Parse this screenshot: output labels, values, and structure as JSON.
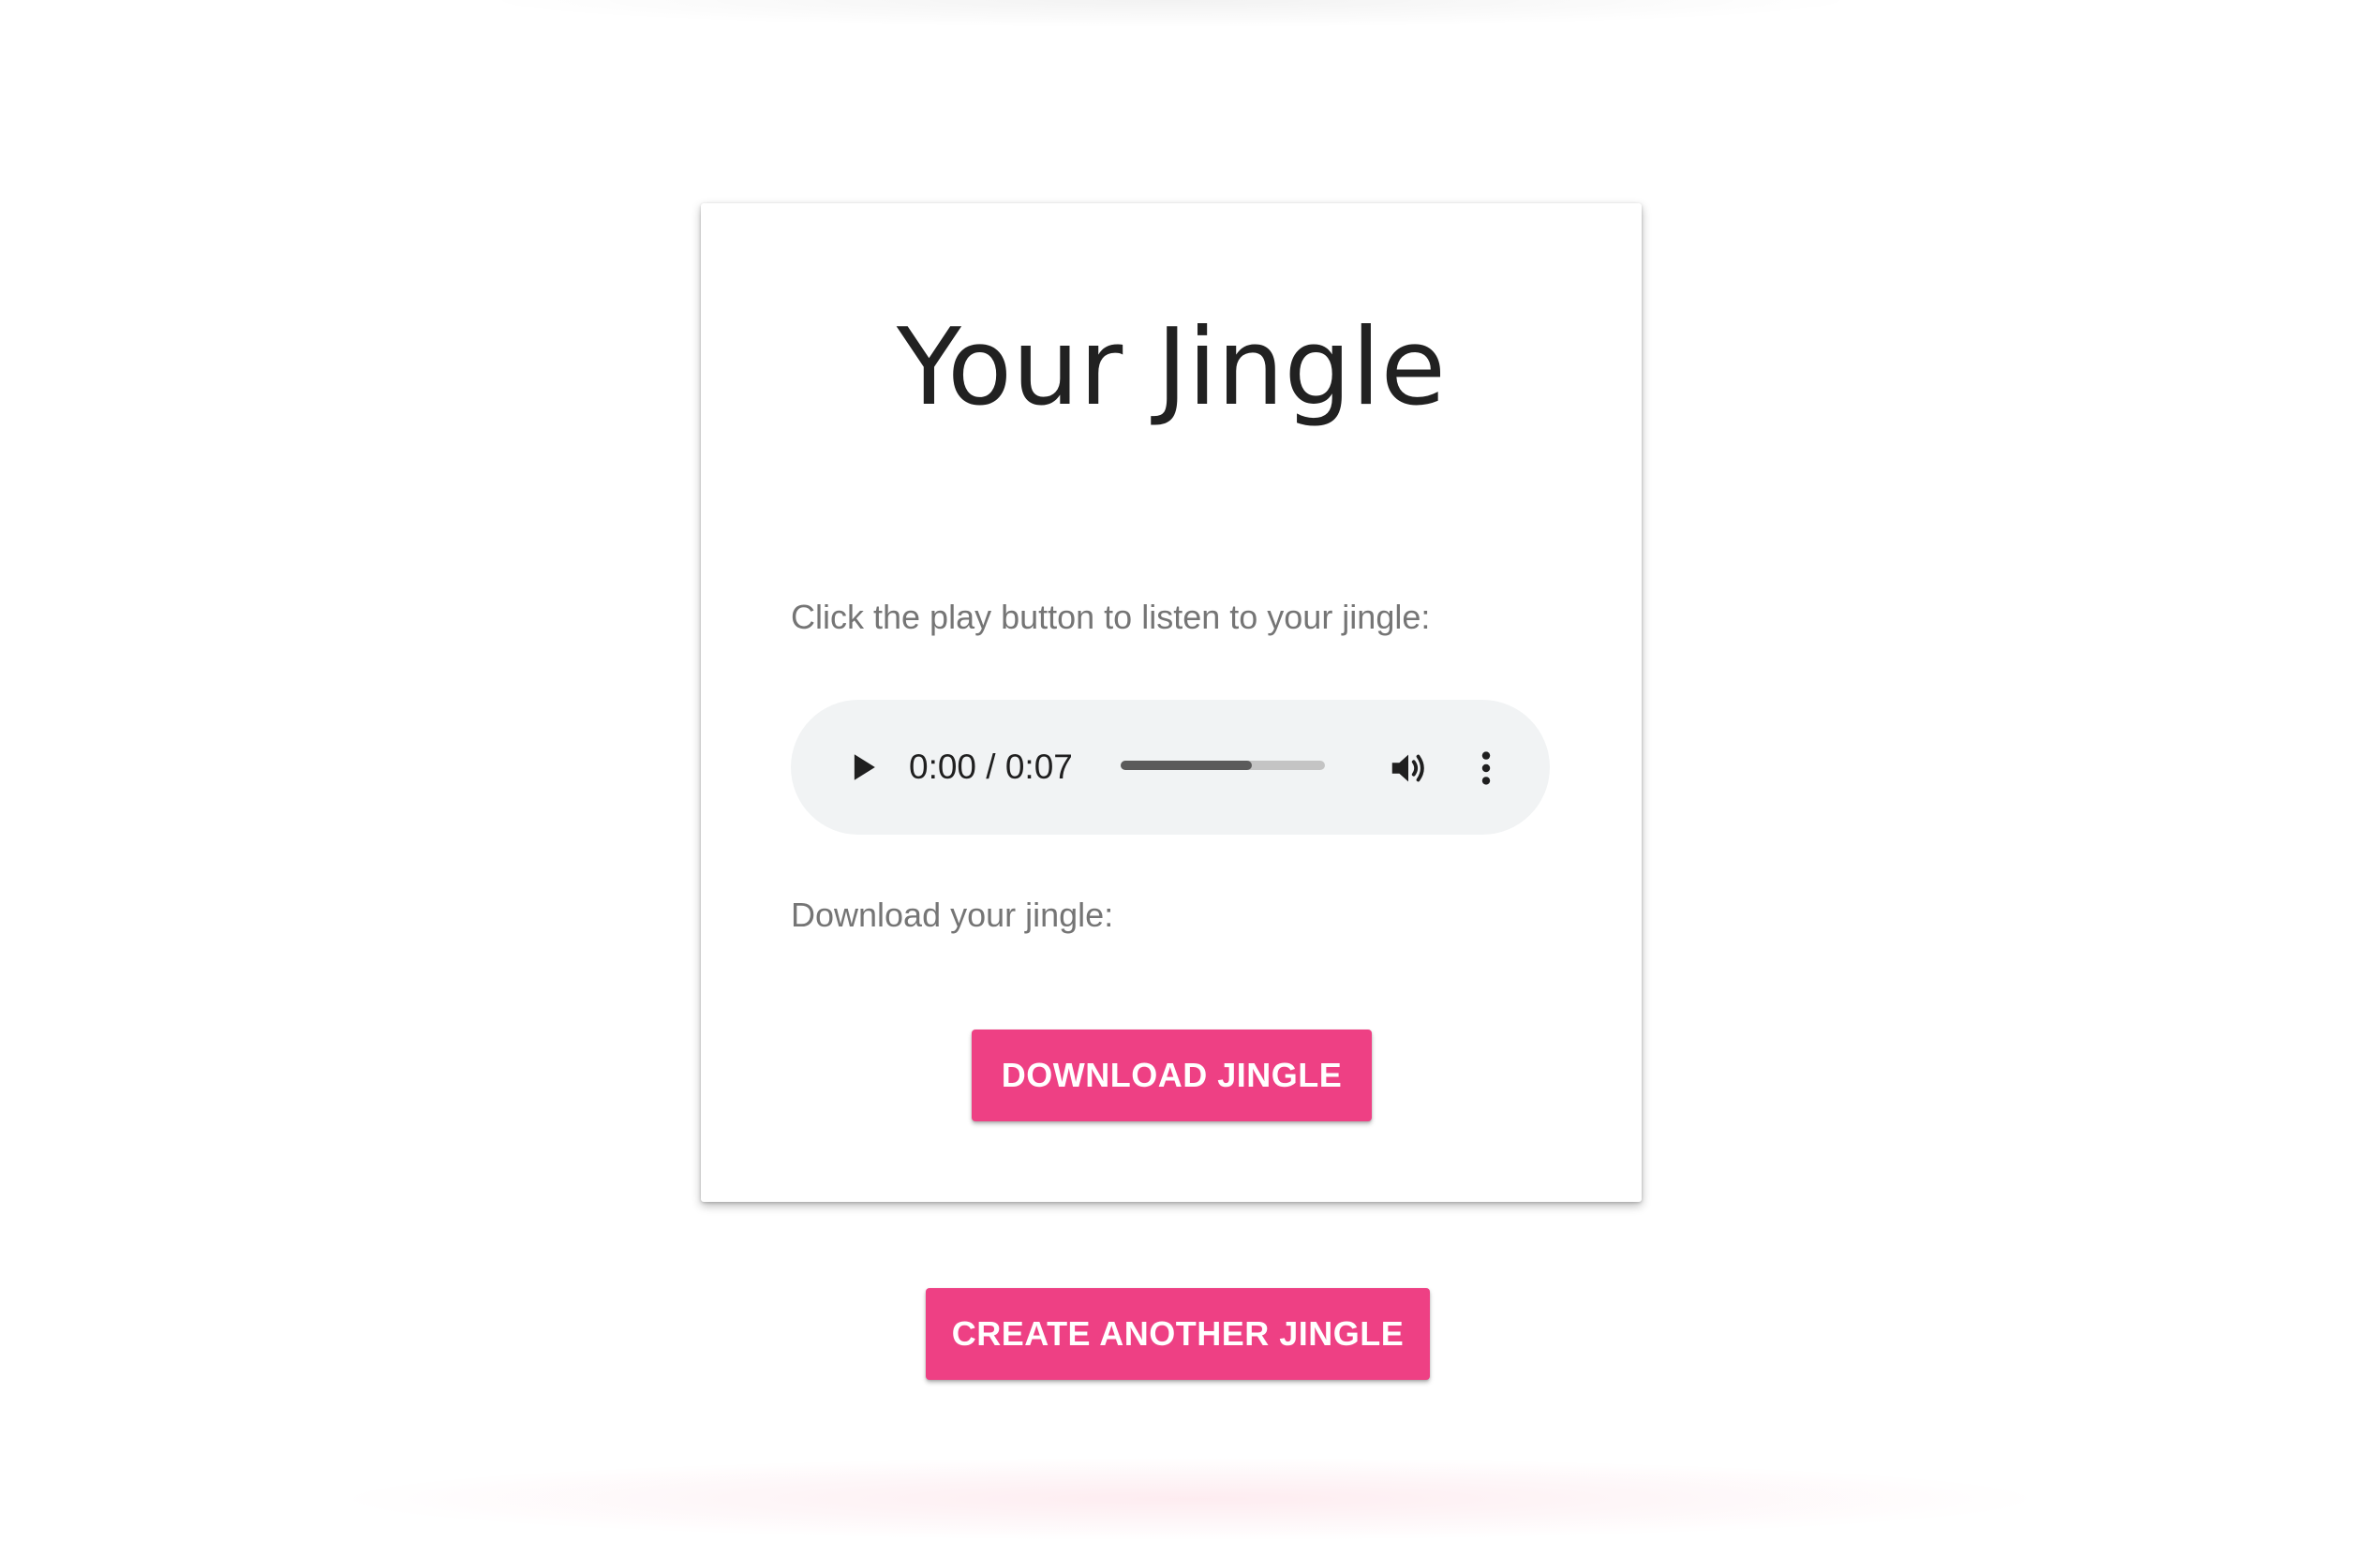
{
  "card": {
    "title": "Your Jingle",
    "play_instruction": "Click the play button to listen to your jingle:",
    "download_instruction": "Download your jingle:",
    "download_button": "DOWNLOAD JINGLE"
  },
  "audio_player": {
    "time_display": "0:00 / 0:07",
    "current_time": "0:00",
    "duration": "0:07",
    "buffered_fraction": 0.64,
    "icons": {
      "play": "play-icon",
      "volume": "volume-icon",
      "more": "more-vert-icon"
    }
  },
  "footer": {
    "create_button": "CREATE ANOTHER JINGLE"
  },
  "colors": {
    "accent": "#ee4084",
    "title_text": "#212121",
    "secondary_text": "#757575",
    "player_background": "#f1f3f4"
  }
}
